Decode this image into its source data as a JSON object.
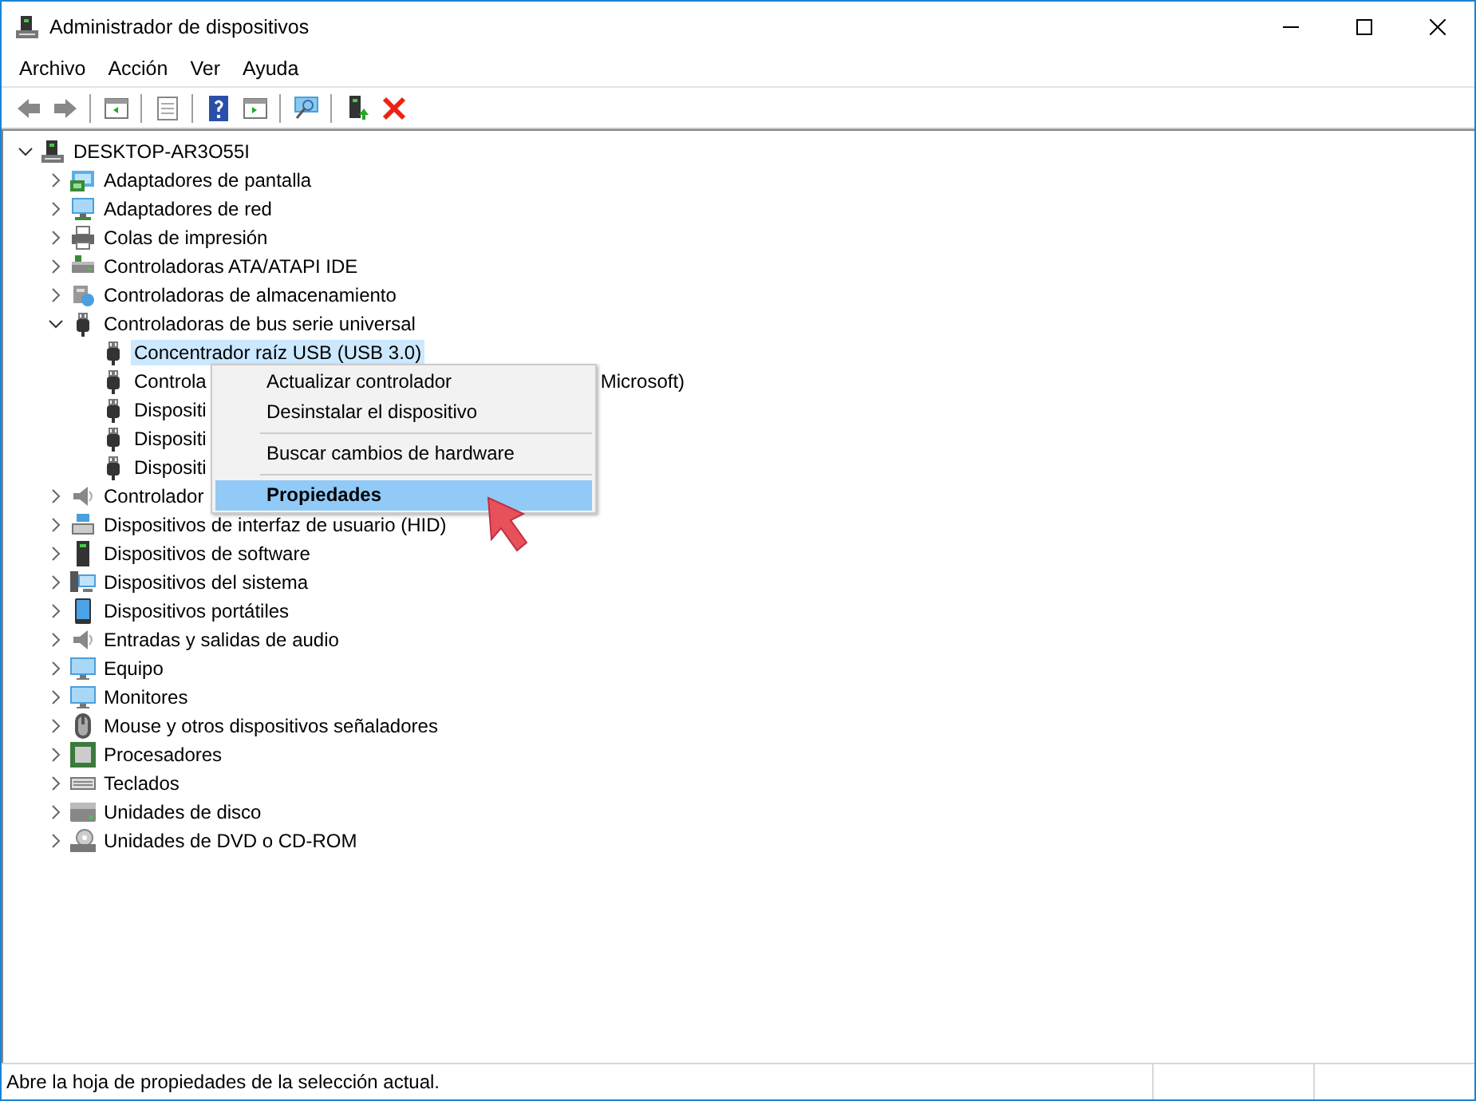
{
  "window": {
    "title": "Administrador de dispositivos"
  },
  "menu_bar": [
    "Archivo",
    "Acción",
    "Ver",
    "Ayuda"
  ],
  "tree": {
    "label": "DESKTOP-AR3O55I",
    "expanded": true,
    "selected": false,
    "children": [
      {
        "label": "Adaptadores de pantalla",
        "expanded": false,
        "selected": false
      },
      {
        "label": "Adaptadores de red",
        "expanded": false,
        "selected": false
      },
      {
        "label": "Colas de impresión",
        "expanded": false,
        "selected": false
      },
      {
        "label": "Controladoras ATA/ATAPI IDE",
        "expanded": false,
        "selected": false
      },
      {
        "label": "Controladoras de almacenamiento",
        "expanded": false,
        "selected": false
      },
      {
        "label": "Controladoras de bus serie universal",
        "expanded": true,
        "selected": false,
        "children": [
          {
            "label": "Concentrador raíz USB (USB 3.0)",
            "selected": true
          },
          {
            "label": "Controla",
            "label_tail": "Microsoft)",
            "selected": false
          },
          {
            "label": "Dispositi",
            "selected": false
          },
          {
            "label": "Dispositi",
            "selected": false
          },
          {
            "label": "Dispositi",
            "selected": false
          }
        ]
      },
      {
        "label": "Controlador",
        "expanded": false,
        "selected": false
      },
      {
        "label": "Dispositivos de interfaz de usuario (HID)",
        "expanded": false,
        "selected": false
      },
      {
        "label": "Dispositivos de software",
        "expanded": false,
        "selected": false
      },
      {
        "label": "Dispositivos del sistema",
        "expanded": false,
        "selected": false
      },
      {
        "label": "Dispositivos portátiles",
        "expanded": false,
        "selected": false
      },
      {
        "label": "Entradas y salidas de audio",
        "expanded": false,
        "selected": false
      },
      {
        "label": "Equipo",
        "expanded": false,
        "selected": false
      },
      {
        "label": "Monitores",
        "expanded": false,
        "selected": false
      },
      {
        "label": "Mouse y otros dispositivos señaladores",
        "expanded": false,
        "selected": false
      },
      {
        "label": "Procesadores",
        "expanded": false,
        "selected": false
      },
      {
        "label": "Teclados",
        "expanded": false,
        "selected": false
      },
      {
        "label": "Unidades de disco",
        "expanded": false,
        "selected": false
      },
      {
        "label": "Unidades de DVD o CD-ROM",
        "expanded": false,
        "selected": false
      }
    ]
  },
  "context_menu": [
    {
      "kind": "item",
      "label": "Actualizar controlador",
      "selected": false
    },
    {
      "kind": "item",
      "label": "Desinstalar el dispositivo",
      "selected": false
    },
    {
      "kind": "separator"
    },
    {
      "kind": "item",
      "label": "Buscar cambios de hardware",
      "selected": false
    },
    {
      "kind": "separator"
    },
    {
      "kind": "item",
      "label": "Propiedades",
      "selected": true
    }
  ],
  "status_bar": {
    "text": "Abre la hoja de propiedades de la selección actual."
  }
}
